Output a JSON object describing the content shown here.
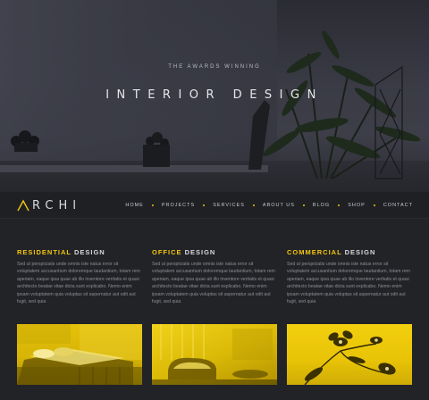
{
  "hero": {
    "subtitle": "THE AWARDS WINNING",
    "title": "INTERIOR DESIGN"
  },
  "brand": {
    "name": "RCHI",
    "accent_color": "#f2c511"
  },
  "nav": {
    "items": [
      "HOME",
      "PROJECTS",
      "SERVICES",
      "ABOUT US",
      "BLOG",
      "SHOP",
      "CONTACT"
    ]
  },
  "sections": [
    {
      "title_accent": "RESIDENTIAL",
      "title_rest": " DESIGN",
      "text": "Sed ut perspiciatis unde omnis iste natus error sit voluptatem accusantium doloremque laudantium, totam rem aperiam, eaque ipsa quae ab illo inventore veritatis et quasi architecto beatae vitae dicta sunt explicabo. Nemo enim ipsam voluptatem quia voluptas sit aspernatur aut odit aut fugit, sed quia",
      "image": "bedroom-photo"
    },
    {
      "title_accent": "OFFICE",
      "title_rest": " DESIGN",
      "text": "Sed ut perspiciatis unde omnis iste natus error sit voluptatem accusantium doloremque laudantium, totam rem aperiam, eaque ipsa quae ab illo inventore veritatis et quasi architecto beatae vitae dicta sunt explicabo. Nemo enim ipsam voluptatem quia voluptas sit aspernatur aut odit aut fugit, sed quia",
      "image": "office-lounge-photo"
    },
    {
      "title_accent": "COMMERCIAL",
      "title_rest": " DESIGN",
      "text": "Sed ut perspiciatis unde omnis iste natus error sit voluptatem accusantium doloremque laudantium, totam rem aperiam, eaque ipsa quae ab illo inventore veritatis et quasi architecto beatae vitae dicta sunt explicabo. Nemo enim ipsam voluptatem quia voluptas sit aspernatur aut odit aut fugit, sed quia",
      "image": "flower-photo"
    }
  ]
}
